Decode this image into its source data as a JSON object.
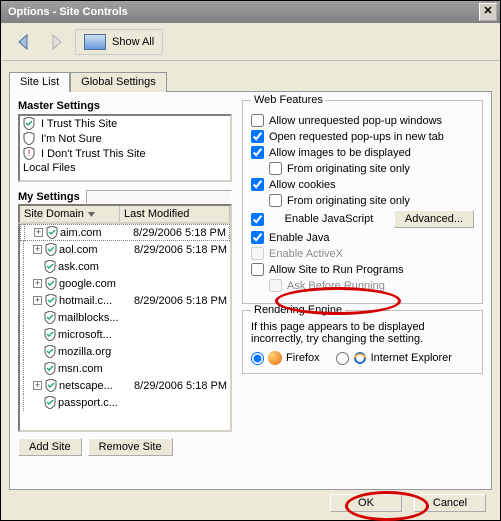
{
  "title": "Options - Site Controls",
  "toolbar": {
    "showall": "Show All"
  },
  "tabs": {
    "site_list": "Site List",
    "global_settings": "Global Settings"
  },
  "master_settings": {
    "heading": "Master Settings",
    "items": [
      {
        "label": "I Trust This Site"
      },
      {
        "label": "I'm Not Sure"
      },
      {
        "label": "I Don't Trust This Site"
      },
      {
        "label": "Local Files"
      }
    ]
  },
  "my_settings": {
    "heading": "My Settings",
    "col1": "Site Domain",
    "col2": "Last Modified",
    "rows": [
      {
        "exp": "+",
        "domain": "aim.com",
        "date": "8/29/2006 5:18 PM",
        "sel": true
      },
      {
        "exp": "+",
        "domain": "aol.com",
        "date": "8/29/2006 5:18 PM"
      },
      {
        "exp": "",
        "domain": "ask.com",
        "date": ""
      },
      {
        "exp": "+",
        "domain": "google.com",
        "date": ""
      },
      {
        "exp": "+",
        "domain": "hotmail.c...",
        "date": "8/29/2006 5:18 PM"
      },
      {
        "exp": "",
        "domain": "mailblocks...",
        "date": ""
      },
      {
        "exp": "",
        "domain": "microsoft...",
        "date": ""
      },
      {
        "exp": "",
        "domain": "mozilla.org",
        "date": ""
      },
      {
        "exp": "",
        "domain": "msn.com",
        "date": ""
      },
      {
        "exp": "+",
        "domain": "netscape...",
        "date": "8/29/2006 5:18 PM"
      },
      {
        "exp": "",
        "domain": "passport.c...",
        "date": ""
      }
    ]
  },
  "buttons": {
    "add_site": "Add Site",
    "remove_site": "Remove Site",
    "advanced": "Advanced...",
    "ok": "OK",
    "cancel": "Cancel"
  },
  "web_features": {
    "legend": "Web Features",
    "popup": {
      "label": "Allow unrequested pop-up windows",
      "checked": false
    },
    "popup_tab": {
      "label": "Open requested pop-ups in new tab",
      "checked": true
    },
    "images": {
      "label": "Allow images to be displayed",
      "checked": true
    },
    "images_orig": {
      "label": "From originating site only",
      "checked": false
    },
    "cookies": {
      "label": "Allow cookies",
      "checked": true
    },
    "cookies_orig": {
      "label": "From originating site only",
      "checked": false
    },
    "js": {
      "label": "Enable JavaScript",
      "checked": true
    },
    "java": {
      "label": "Enable Java",
      "checked": true
    },
    "activex": {
      "label": "Enable ActiveX",
      "checked": false,
      "disabled": true
    },
    "runprog": {
      "label": "Allow Site to Run Programs",
      "checked": false
    },
    "askbefore": {
      "label": "Ask Before Running",
      "checked": false,
      "disabled": true
    }
  },
  "rendering": {
    "legend": "Rendering Engine",
    "text": "If this page appears to be displayed incorrectly, try changing the setting.",
    "firefox": "Firefox",
    "ie": "Internet Explorer"
  }
}
